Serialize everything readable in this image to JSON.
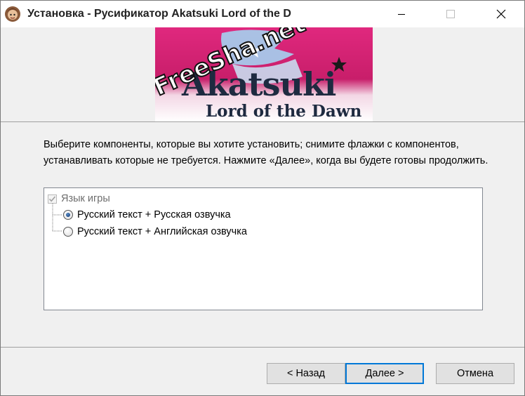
{
  "window": {
    "title": "Установка - Русификатор Akatsuki Lord of the D"
  },
  "titlebar": {
    "minimize_icon": "minimize-icon",
    "maximize_icon": "maximize-icon",
    "close_icon": "close-icon"
  },
  "banner": {
    "logo_title": "Akatsuki",
    "logo_subtitle": "Lord of the Dawn",
    "watermark": "FreeSha.net"
  },
  "instructions": "Выберите компоненты, которые вы хотите установить; снимите флажки с компонентов, устанавливать которые не требуется. Нажмите «Далее», когда вы будете готовы продолжить.",
  "components": {
    "root": {
      "label": "Язык игры",
      "checked": true,
      "disabled": true
    },
    "options": [
      {
        "label": "Русский текст + Русская озвучка",
        "selected": true
      },
      {
        "label": "Русский текст + Английская озвучка",
        "selected": false
      }
    ]
  },
  "buttons": {
    "back": "< Назад",
    "next": "Далее >",
    "cancel": "Отмена"
  },
  "colors": {
    "banner_pink": "#d21f72",
    "banner_flag": "#a6c9ea",
    "focus_blue": "#0078d7"
  }
}
